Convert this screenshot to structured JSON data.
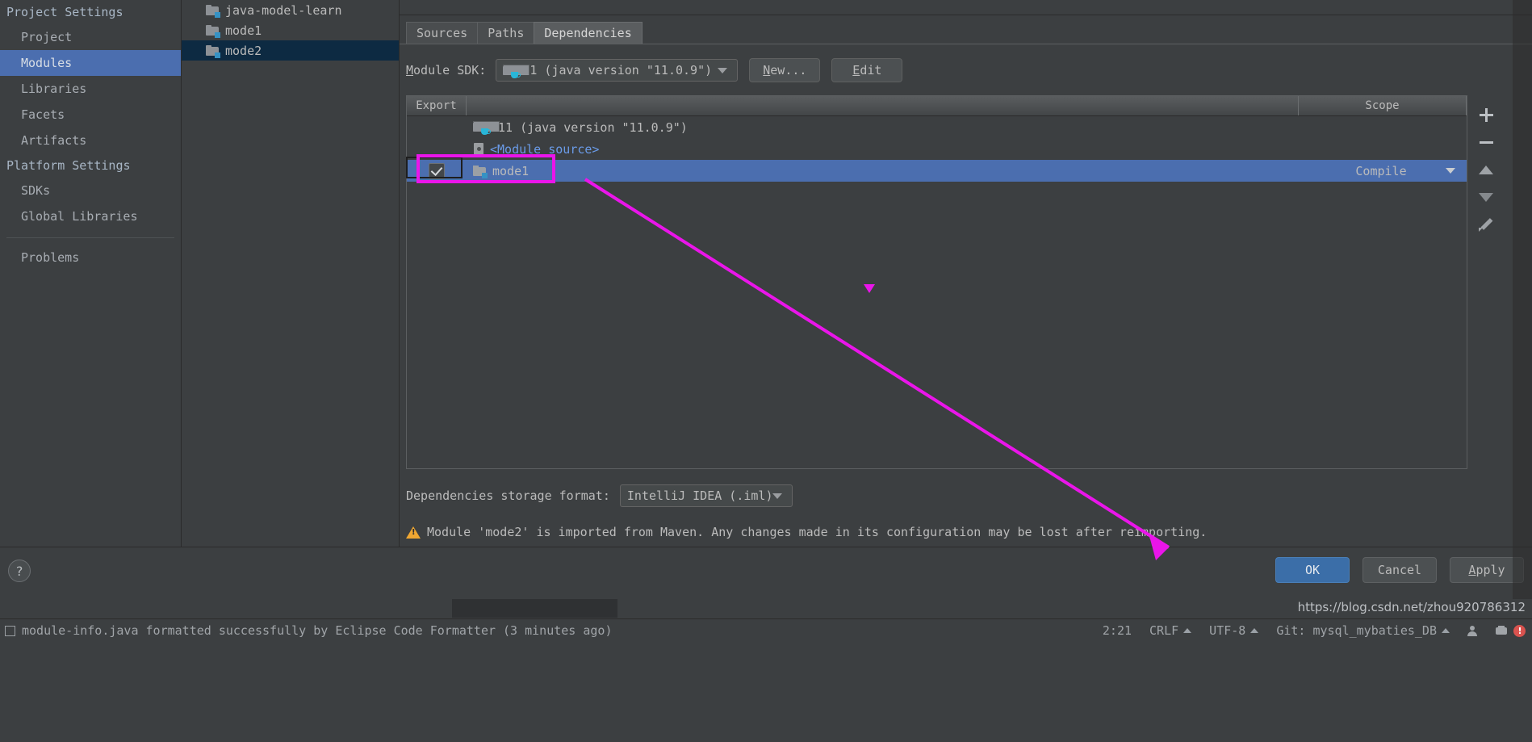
{
  "sidebar": {
    "groups": [
      {
        "title": "Project Settings",
        "items": [
          {
            "label": "Project",
            "selected": false
          },
          {
            "label": "Modules",
            "selected": true
          },
          {
            "label": "Libraries",
            "selected": false
          },
          {
            "label": "Facets",
            "selected": false
          },
          {
            "label": "Artifacts",
            "selected": false
          }
        ]
      },
      {
        "title": "Platform Settings",
        "items": [
          {
            "label": "SDKs",
            "selected": false
          },
          {
            "label": "Global Libraries",
            "selected": false
          }
        ]
      }
    ],
    "problems_label": "Problems"
  },
  "module_tree": {
    "nodes": [
      {
        "label": "java-model-learn",
        "icon": "module-folder-icon",
        "selected": false
      },
      {
        "label": "mode1",
        "icon": "module-folder-icon",
        "selected": false
      },
      {
        "label": "mode2",
        "icon": "module-folder-icon",
        "selected": true
      }
    ]
  },
  "tabs": [
    {
      "label": "Sources",
      "active": false
    },
    {
      "label": "Paths",
      "active": false
    },
    {
      "label": "Dependencies",
      "active": true
    }
  ],
  "sdk_row": {
    "label": "Module SDK:",
    "label_mnemonic": "M",
    "label_rest": "odule SDK:",
    "value": "11 (java version \"11.0.9\")",
    "new_button": "New...",
    "new_mnemonic": "N",
    "new_rest": "ew...",
    "edit_button": "Edit",
    "edit_mnemonic": "E",
    "edit_rest": "dit"
  },
  "dependencies_table": {
    "columns": {
      "export": "Export",
      "scope": "Scope"
    },
    "rows": [
      {
        "export_checked": null,
        "name": "11 (java version \"11.0.9\")",
        "icon": "jdk-icon",
        "scope": "",
        "selected": false,
        "style": "normal"
      },
      {
        "export_checked": null,
        "name": "<Module source>",
        "icon": "source-file-icon",
        "scope": "",
        "selected": false,
        "style": "link"
      },
      {
        "export_checked": true,
        "name": "mode1",
        "icon": "module-folder-icon",
        "scope": "Compile",
        "selected": true,
        "style": "normal"
      }
    ]
  },
  "table_toolbar": [
    {
      "name": "add",
      "glyph": "plus"
    },
    {
      "name": "remove",
      "glyph": "minus"
    },
    {
      "name": "move-up",
      "glyph": "up"
    },
    {
      "name": "move-down",
      "glyph": "down"
    },
    {
      "name": "edit",
      "glyph": "pencil"
    }
  ],
  "storage_row": {
    "label": "Dependencies storage format:",
    "value": "IntelliJ IDEA (.iml)"
  },
  "warning": {
    "text": "Module 'mode2' is imported from Maven. Any changes made in its configuration may be lost after reimporting."
  },
  "footer": {
    "help": "?",
    "ok": "OK",
    "cancel": "Cancel",
    "apply": "Apply",
    "apply_mnemonic": "A",
    "apply_rest": "pply"
  },
  "status_bar": {
    "message": "module-info.java formatted successfully by Eclipse Code Formatter (3 minutes ago)",
    "caret_position": "2:21",
    "line_separator": "CRLF",
    "encoding": "UTF-8",
    "git_branch": "Git: mysql_mybaties_DB",
    "watermark": "https://blog.csdn.net/zhou920786312"
  },
  "annotations": {
    "highlight_color": "#ea15ea",
    "highlight_target": "export-checkbox-and-mode1-cell"
  },
  "colors": {
    "window_bg": "#3c3f41",
    "selection_blue": "#4b6eaf",
    "tree_selection": "#0d2a42",
    "text": "#bbbbbb",
    "link": "#6a9be8",
    "accent_magenta": "#ea15ea",
    "warning_amber": "#f0a732",
    "primary_button": "#3b6ea8"
  }
}
